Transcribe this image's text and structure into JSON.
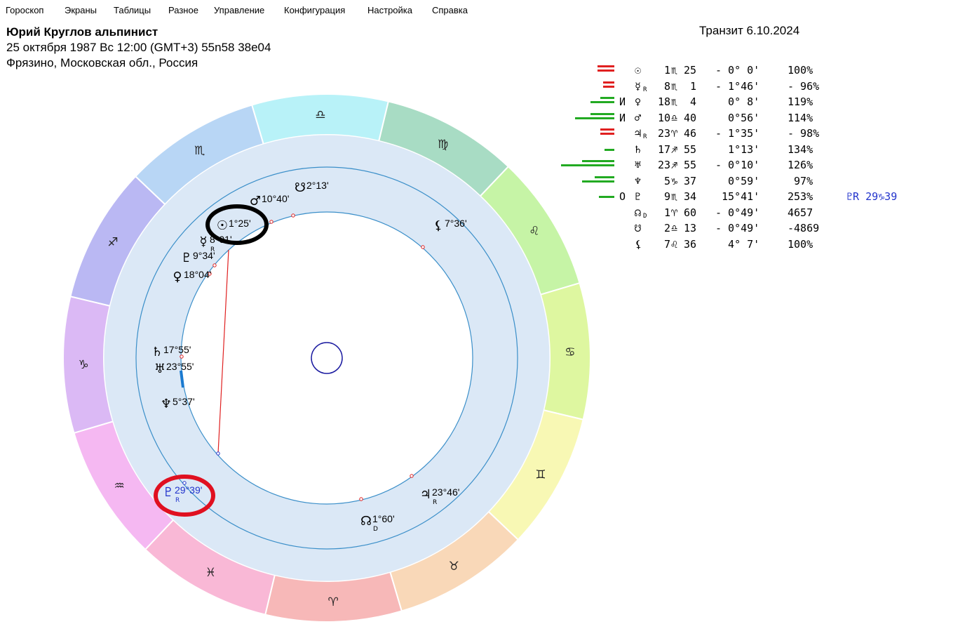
{
  "menu": [
    "Гороскоп",
    "Экраны",
    "Таблицы",
    "Разное",
    "Управление",
    "Конфигурация",
    "Настройка",
    "Справка"
  ],
  "header": {
    "name": "Юрий Круглов альпинист",
    "line2": "25 октября 1987  Вс  12:00 (GMT+3) 55n58  38e04",
    "line3": "Фрязино, Московская обл., Россия",
    "transit": "Транзит  6.10.2024"
  },
  "colors": {
    "wheel": "#dbe8f6",
    "ring_line": "#3b8fc9",
    "aspect_red": "#e02020",
    "marker_black": "#000000",
    "marker_red": "#e01020",
    "bar_green": "#22aa22",
    "bar_red": "#e02020",
    "blue_text": "#2233cc"
  },
  "zodiac": [
    {
      "sign": "♍",
      "name": "virgo",
      "color": "#a8dcc4"
    },
    {
      "sign": "♌",
      "name": "leo",
      "color": "#c6f4a6"
    },
    {
      "sign": "♋",
      "name": "cancer",
      "color": "#def7a0"
    },
    {
      "sign": "♊",
      "name": "gemini",
      "color": "#f8f8b4"
    },
    {
      "sign": "♉",
      "name": "taurus",
      "color": "#f9d8b8"
    },
    {
      "sign": "♈",
      "name": "aries",
      "color": "#f7b8b8"
    },
    {
      "sign": "♓",
      "name": "pisces",
      "color": "#f9b8d6"
    },
    {
      "sign": "♒",
      "name": "aquarius",
      "color": "#f5b8f2"
    },
    {
      "sign": "♑",
      "name": "capricorn",
      "color": "#dbb9f5"
    },
    {
      "sign": "♐",
      "name": "sagittarius",
      "color": "#bab8f3"
    },
    {
      "sign": "♏",
      "name": "scorpio",
      "color": "#b8d6f5"
    },
    {
      "sign": "♎",
      "name": "libra",
      "color": "#b8f2f8"
    }
  ],
  "wheel_labels": [
    {
      "glyph": "☉",
      "text": "1°25'",
      "name": "sun"
    },
    {
      "glyph": "♂",
      "text": "10°40'",
      "name": "mars"
    },
    {
      "glyph": "☋",
      "text": "2°13'",
      "name": "south-node"
    },
    {
      "glyph": "⚸",
      "text": "7°36'",
      "name": "lilith"
    },
    {
      "glyph": "☿",
      "text": "8°01'",
      "name": "mercury",
      "sub": "R"
    },
    {
      "glyph": "♇",
      "text": "9°34'",
      "name": "pluto"
    },
    {
      "glyph": "♀",
      "text": "18°04'",
      "name": "venus"
    },
    {
      "glyph": "♄",
      "text": "17°55'",
      "name": "saturn"
    },
    {
      "glyph": "♅",
      "text": "23°55'",
      "name": "uranus"
    },
    {
      "glyph": "♆",
      "text": "5°37'",
      "name": "neptune"
    },
    {
      "glyph": "♇",
      "text": "29°39'",
      "name": "transit-pluto",
      "sub": "R"
    },
    {
      "glyph": "♃",
      "text": "23°46'",
      "name": "jupiter",
      "sub": "R"
    },
    {
      "glyph": "☊",
      "text": "1°60'",
      "name": "north-node",
      "sub": "D"
    }
  ],
  "table": [
    {
      "bars": [
        {
          "w": 24,
          "c": "red"
        },
        {
          "w": 0,
          "c": ""
        }
      ],
      "mark": "",
      "glyph": "☉",
      "sub": "",
      "deg": " 1",
      "sign": "♏",
      "min": "25",
      "orb": "- 0° 0'",
      "pct": "100%"
    },
    {
      "bars": [
        {
          "w": 16,
          "c": "red"
        }
      ],
      "mark": "",
      "glyph": "☿",
      "sub": "R",
      "deg": " 8",
      "sign": "♏",
      "min": " 1",
      "orb": "- 1°46'",
      "pct": "- 96%"
    },
    {
      "bars": [
        {
          "w": 34,
          "c": "green"
        }
      ],
      "mark": "И",
      "glyph": "♀",
      "sub": "",
      "deg": "18",
      "sign": "♏",
      "min": " 4",
      "orb": "  0° 8'",
      "pct": "119%"
    },
    {
      "bars": [
        {
          "w": 56,
          "c": "green"
        }
      ],
      "mark": "И",
      "glyph": "♂",
      "sub": "",
      "deg": "10",
      "sign": "♎",
      "min": "40",
      "orb": "  0°56'",
      "pct": "114%"
    },
    {
      "bars": [
        {
          "w": 20,
          "c": "red"
        }
      ],
      "mark": "",
      "glyph": "♃",
      "sub": "R",
      "deg": "23",
      "sign": "♈",
      "min": "46",
      "orb": "- 1°35'",
      "pct": "- 98%"
    },
    {
      "bars": [
        {
          "w": 14,
          "c": "green"
        }
      ],
      "mark": "",
      "glyph": "♄",
      "sub": "",
      "deg": "17",
      "sign": "♐",
      "min": "55",
      "orb": "  1°13'",
      "pct": "134%"
    },
    {
      "bars": [
        {
          "w": 76,
          "c": "green"
        }
      ],
      "mark": "",
      "glyph": "♅",
      "sub": "",
      "deg": "23",
      "sign": "♐",
      "min": "55",
      "orb": "- 0°10'",
      "pct": "126%"
    },
    {
      "bars": [
        {
          "w": 46,
          "c": "green"
        }
      ],
      "mark": "",
      "glyph": "♆",
      "sub": "",
      "deg": " 5",
      "sign": "♑",
      "min": "37",
      "orb": "  0°59'",
      "pct": " 97%"
    },
    {
      "bars": [
        {
          "w": 22,
          "c": "green"
        }
      ],
      "mark": "О",
      "glyph": "♇",
      "sub": "",
      "deg": " 9",
      "sign": "♏",
      "min": "34",
      "orb": " 15°41'",
      "pct": "253%",
      "extra": "♇R 29♑39"
    },
    {
      "bars": [],
      "mark": "",
      "glyph": "☊",
      "sub": "D",
      "deg": " 1",
      "sign": "♈",
      "min": "60",
      "orb": "- 0°49'",
      "pct": "4657"
    },
    {
      "bars": [],
      "mark": "",
      "glyph": "☋",
      "sub": "",
      "deg": " 2",
      "sign": "♎",
      "min": "13",
      "orb": "- 0°49'",
      "pct": "-4869"
    },
    {
      "bars": [],
      "mark": "",
      "glyph": "⚸",
      "sub": "",
      "deg": " 7",
      "sign": "♌",
      "min": "36",
      "orb": "  4° 7'",
      "pct": "100%"
    }
  ]
}
